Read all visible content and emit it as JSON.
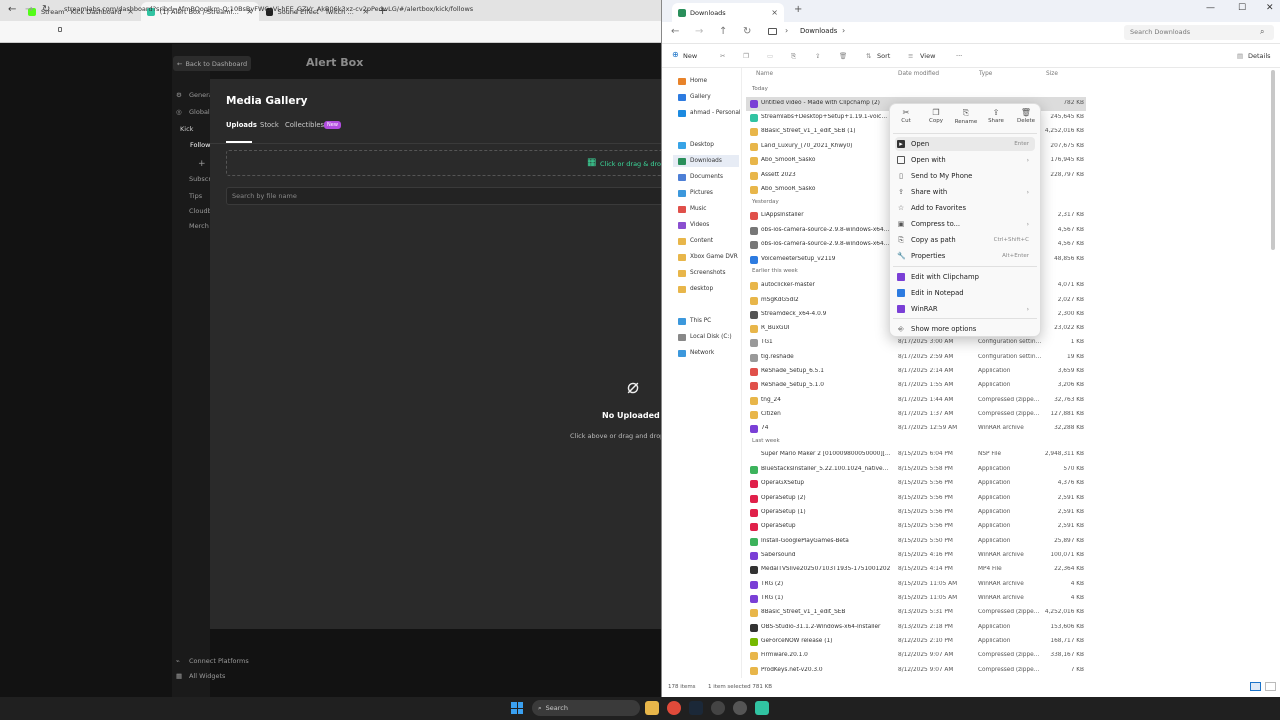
{
  "browser": {
    "tabs": [
      {
        "label": "Stream · Kick Dashboard",
        "color": "#53fc18"
      },
      {
        "label": "(1) Alert Box / Streamlabs",
        "color": "#31c3a2"
      },
      {
        "label": "Sound Effect · Twitch Follower",
        "color": "#222222"
      }
    ],
    "url": "streamlabs.com/dashboard?sribd=AfmBOoglkm-Q;10BsByFWCeVi-hEE_GZVr_AkB06k3xz-cv2pPedwLG/#/alertbox/kick/follows"
  },
  "streamlabs": {
    "back_label": "Back to Dashboard",
    "page_title": "Alert Box",
    "nav": [
      "General",
      "Global",
      "Kick",
      "Follow",
      "+",
      "Subscr",
      "Tips",
      "Cloudb",
      "Merch"
    ],
    "bottom_links": [
      "Connect Platforms",
      "All Widgets"
    ],
    "gallery_title": "Media Gallery",
    "tabs": [
      "Uploads",
      "Stock",
      "Collectibles"
    ],
    "new_badge": "New",
    "drop_text": "Click or drag & drop",
    "search_placeholder": "Search by file name",
    "empty_title": "No Uploaded Me",
    "empty_sub": "Click above or drag and drop"
  },
  "explorer": {
    "tab_title": "Downloads",
    "breadcrumb": "Downloads",
    "search_placeholder": "Search Downloads",
    "commands": [
      "New",
      "Sort",
      "View",
      "···",
      "Details"
    ],
    "sidebar": [
      {
        "label": "Home",
        "color": "#e8832a"
      },
      {
        "label": "Gallery",
        "color": "#2d7be0"
      },
      {
        "label": "ahmad - Personal",
        "color": "#1c8ae0"
      },
      {
        "label": "Desktop",
        "color": "#37a3e6"
      },
      {
        "label": "Downloads",
        "color": "#2a8f5b"
      },
      {
        "label": "Documents",
        "color": "#4d7fd6"
      },
      {
        "label": "Pictures",
        "color": "#3c98dc"
      },
      {
        "label": "Music",
        "color": "#e0504a"
      },
      {
        "label": "Videos",
        "color": "#8a4fd0"
      },
      {
        "label": "Content",
        "color": "#e8b64a"
      },
      {
        "label": "Xbox Game DVR",
        "color": "#e8b64a"
      },
      {
        "label": "Screenshots",
        "color": "#e8b64a"
      },
      {
        "label": "desktop",
        "color": "#e8b64a"
      },
      {
        "label": "This PC",
        "color": "#3c98dc"
      },
      {
        "label": "Local Disk (C:)",
        "color": "#888888"
      },
      {
        "label": "Network",
        "color": "#3c98dc"
      }
    ],
    "columns": [
      "Name",
      "Date modified",
      "Type",
      "Size"
    ],
    "groups": [
      "Today",
      "Yesterday",
      "Earlier this week",
      "Last week"
    ],
    "rows": [
      {
        "name": "Untitled video - Made with Clipchamp (2)",
        "date": "",
        "type": "",
        "size": "782 KB",
        "color": "#7a3fd6"
      },
      {
        "name": "Streamlabs+Desktop+Setup+1.19.1-voicDwp34...",
        "date": "",
        "type": "",
        "size": "245,645 KB",
        "color": "#31c3a2"
      },
      {
        "name": "8Basic_Street_v1_1_edit_SEB (1)",
        "date": "",
        "type": "",
        "size": "4,252,016 KB",
        "color": "#e8b64a"
      },
      {
        "name": "Land_Luxury_(70_2021_Khwy0)",
        "date": "",
        "type": "",
        "size": "207,675 KB",
        "color": "#e8b64a"
      },
      {
        "name": "Abo_SmooR_Sasko",
        "date": "",
        "type": "",
        "size": "176,945 KB",
        "color": "#e8b64a"
      },
      {
        "name": "Assett 2023",
        "date": "",
        "type": "",
        "size": "228,797 KB",
        "color": "#e8b64a"
      },
      {
        "name": "Abo_SmooR_Sasko",
        "date": "",
        "type": "",
        "size": "",
        "color": "#e8b64a"
      },
      {
        "name": "LiAppsInstaller",
        "date": "",
        "type": "",
        "size": "2,317 KB",
        "color": "#e0504a"
      },
      {
        "name": "obs-ios-camera-source-2.9.8-windows-x64-inst...",
        "date": "",
        "type": "",
        "size": "4,567 KB",
        "color": "#777777"
      },
      {
        "name": "obs-ios-camera-source-2.9.8-windows-x64-inst...",
        "date": "",
        "type": "",
        "size": "4,567 KB",
        "color": "#777777"
      },
      {
        "name": "VoicemeeterSetup_v2119",
        "date": "",
        "type": "",
        "size": "48,856 KB",
        "color": "#2d7be0"
      },
      {
        "name": "autoclicker-master",
        "date": "",
        "type": "",
        "size": "4,071 KB",
        "color": "#e8b64a"
      },
      {
        "name": "mSgKdG5dl2",
        "date": "",
        "type": "",
        "size": "2,027 KB",
        "color": "#e8b64a"
      },
      {
        "name": "Streamdeck_x64-4.0.9",
        "date": "",
        "type": "",
        "size": "2,300 KB",
        "color": "#555555"
      },
      {
        "name": "R_BuxGUI",
        "date": "",
        "type": "",
        "size": "23,022 KB",
        "color": "#e8b64a"
      },
      {
        "name": "TG1",
        "date": "8/17/2025 3:00 AM",
        "type": "Configuration settings",
        "size": "1 KB",
        "color": "#999999"
      },
      {
        "name": "tig.reshade",
        "date": "8/17/2025 2:59 AM",
        "type": "Configuration settings",
        "size": "19 KB",
        "color": "#999999"
      },
      {
        "name": "ReShade_Setup_6.5.1",
        "date": "8/17/2025 2:14 AM",
        "type": "Application",
        "size": "3,659 KB",
        "color": "#e0504a"
      },
      {
        "name": "ReShade_Setup_5.1.0",
        "date": "8/17/2025 1:55 AM",
        "type": "Application",
        "size": "3,206 KB",
        "color": "#e0504a"
      },
      {
        "name": "tng_24",
        "date": "8/17/2025 1:44 AM",
        "type": "Compressed (zipped)...",
        "size": "32,763 KB",
        "color": "#e8b64a"
      },
      {
        "name": "Citizen",
        "date": "8/17/2025 1:37 AM",
        "type": "Compressed (zipped)...",
        "size": "127,881 KB",
        "color": "#e8b64a"
      },
      {
        "name": "74",
        "date": "8/17/2025 12:59 AM",
        "type": "WinRAR archive",
        "size": "32,288 KB",
        "color": "#7a3fd6"
      },
      {
        "name": "Super Mario Maker 2 [010009800050000][v0]...",
        "date": "8/15/2025 6:04 PM",
        "type": "NSP File",
        "size": "2,948,311 KB",
        "color": "#ffffff"
      },
      {
        "name": "BlueStacksInstaller_5.22.100.1024_native_8f9641...",
        "date": "8/15/2025 5:58 PM",
        "type": "Application",
        "size": "570 KB",
        "color": "#3cb35c"
      },
      {
        "name": "OperaGXSetup",
        "date": "8/15/2025 5:56 PM",
        "type": "Application",
        "size": "4,376 KB",
        "color": "#e0204a"
      },
      {
        "name": "OperaSetup (2)",
        "date": "8/15/2025 5:56 PM",
        "type": "Application",
        "size": "2,591 KB",
        "color": "#e0204a"
      },
      {
        "name": "OperaSetup (1)",
        "date": "8/15/2025 5:56 PM",
        "type": "Application",
        "size": "2,591 KB",
        "color": "#e0204a"
      },
      {
        "name": "OperaSetup",
        "date": "8/15/2025 5:56 PM",
        "type": "Application",
        "size": "2,591 KB",
        "color": "#e0204a"
      },
      {
        "name": "Install-GooglePlayGames-Beta",
        "date": "8/15/2025 5:50 PM",
        "type": "Application",
        "size": "25,897 KB",
        "color": "#3cb35c"
      },
      {
        "name": "Sabersound",
        "date": "8/15/2025 4:16 PM",
        "type": "WinRAR archive",
        "size": "100,071 KB",
        "color": "#7a3fd6"
      },
      {
        "name": "MedalTVSlive202507103T1935-1751001202",
        "date": "8/15/2025 4:14 PM",
        "type": "MP4 File",
        "size": "22,364 KB",
        "color": "#333333"
      },
      {
        "name": "TRG (2)",
        "date": "8/15/2025 11:05 AM",
        "type": "WinRAR archive",
        "size": "4 KB",
        "color": "#7a3fd6"
      },
      {
        "name": "TRG (1)",
        "date": "8/15/2025 11:05 AM",
        "type": "WinRAR archive",
        "size": "4 KB",
        "color": "#7a3fd6"
      },
      {
        "name": "8Basic_Street_v1_1_edit_SEB",
        "date": "8/13/2025 5:31 PM",
        "type": "Compressed (zipped)...",
        "size": "4,252,016 KB",
        "color": "#e8b64a"
      },
      {
        "name": "OBS-Studio-31.1.2-Windows-x64-Installer",
        "date": "8/13/2025 2:18 PM",
        "type": "Application",
        "size": "153,606 KB",
        "color": "#333333"
      },
      {
        "name": "GeForceNOW release (1)",
        "date": "8/12/2025 2:10 PM",
        "type": "Application",
        "size": "168,717 KB",
        "color": "#76b900"
      },
      {
        "name": "Firmware.20.1.0",
        "date": "8/12/2025 9:07 AM",
        "type": "Compressed (zipped)...",
        "size": "338,167 KB",
        "color": "#e8b64a"
      },
      {
        "name": "ProdKeys.net-v20.3.0",
        "date": "8/12/2025 9:07 AM",
        "type": "Compressed (zipped)...",
        "size": "7 KB",
        "color": "#e8b64a"
      }
    ],
    "status_count": "178 items",
    "status_selected": "1 item selected  781 KB"
  },
  "context_menu": {
    "quick_actions": [
      "Cut",
      "Copy",
      "Rename",
      "Share",
      "Delete"
    ],
    "items": [
      {
        "label": "Open",
        "shortcut": "Enter"
      },
      {
        "label": "Open with",
        "shortcut": ""
      },
      {
        "label": "Send to My Phone",
        "shortcut": ""
      },
      {
        "label": "Share with",
        "shortcut": ""
      },
      {
        "label": "Add to Favorites",
        "shortcut": ""
      },
      {
        "label": "Compress to...",
        "shortcut": ""
      },
      {
        "label": "Copy as path",
        "shortcut": "Ctrl+Shift+C"
      },
      {
        "label": "Properties",
        "shortcut": "Alt+Enter"
      },
      {
        "label": "Edit with Clipchamp",
        "shortcut": ""
      },
      {
        "label": "Edit in Notepad",
        "shortcut": ""
      },
      {
        "label": "WinRAR",
        "shortcut": ""
      },
      {
        "label": "Show more options",
        "shortcut": ""
      }
    ]
  },
  "taskbar": {
    "search_label": "Search"
  }
}
